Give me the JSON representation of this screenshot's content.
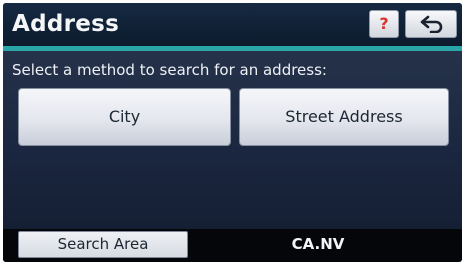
{
  "header": {
    "title": "Address",
    "help_label": "?",
    "back_icon": "back-arrow-icon"
  },
  "main": {
    "prompt": "Select a method to search for an address:",
    "options": [
      {
        "label": "City"
      },
      {
        "label": "Street Address"
      }
    ]
  },
  "footer": {
    "search_area_label": "Search Area",
    "search_area_value": "CA.NV"
  },
  "colors": {
    "accent_line": "#2aa6a8",
    "help_mark": "#d9342b",
    "background": "#1b2740"
  }
}
